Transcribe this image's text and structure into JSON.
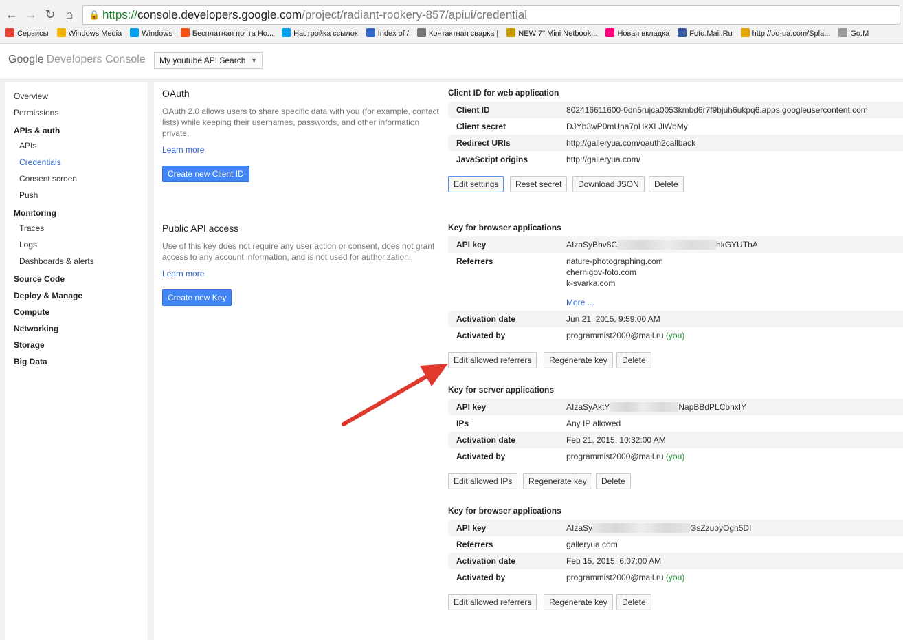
{
  "browser": {
    "url_scheme": "https://",
    "url_host": "console.developers.google.com",
    "url_path": "/project/radiant-rookery-857/apiui/credential",
    "bookmarks": [
      {
        "label": "Сервисы",
        "color": "#e94235"
      },
      {
        "label": "Windows Media",
        "color": "#f4b400"
      },
      {
        "label": "Windows",
        "color": "#00a1f1"
      },
      {
        "label": "Бесплатная почта Но...",
        "color": "#f65314"
      },
      {
        "label": "Настройка ссылок",
        "color": "#00a1f1"
      },
      {
        "label": "Index of /",
        "color": "#3366cc"
      },
      {
        "label": "Контактная сварка |",
        "color": "#777777"
      },
      {
        "label": "NEW 7\" Mini Netbook...",
        "color": "#c89b00"
      },
      {
        "label": "Новая вкладка",
        "color": "#ff0084"
      },
      {
        "label": "Foto.Mail.Ru",
        "color": "#3a5ba0"
      },
      {
        "label": "http://po-ua.com/Spla...",
        "color": "#e3a600"
      },
      {
        "label": "Go.M",
        "color": "#999999"
      }
    ]
  },
  "header": {
    "logo_google": "Google",
    "logo_product": "Developers Console",
    "project_select": "My youtube API Search"
  },
  "sidebar": {
    "items": [
      {
        "label": "Overview"
      },
      {
        "label": "Permissions"
      },
      {
        "label": "APIs & auth"
      },
      {
        "label": "APIs"
      },
      {
        "label": "Credentials"
      },
      {
        "label": "Consent screen"
      },
      {
        "label": "Push"
      },
      {
        "label": "Monitoring"
      },
      {
        "label": "Traces"
      },
      {
        "label": "Logs"
      },
      {
        "label": "Dashboards & alerts"
      },
      {
        "label": "Source Code"
      },
      {
        "label": "Deploy & Manage"
      },
      {
        "label": "Compute"
      },
      {
        "label": "Networking"
      },
      {
        "label": "Storage"
      },
      {
        "label": "Big Data"
      }
    ]
  },
  "oauth": {
    "title": "OAuth",
    "description": "OAuth 2.0 allows users to share specific data with you (for example, contact lists) while keeping their usernames, passwords, and other information private.",
    "learn_more": "Learn more",
    "create_button": "Create new Client ID"
  },
  "public_api": {
    "title": "Public API access",
    "description": "Use of this key does not require any user action or consent, does not grant access to any account information, and is not used for authorization.",
    "learn_more": "Learn more",
    "create_button": "Create new Key"
  },
  "web_client": {
    "title": "Client ID for web application",
    "client_id_label": "Client ID",
    "client_id": "802416611600-0dn5rujca0053kmbd6r7f9bjuh6ukpq6.apps.googleusercontent.com",
    "client_secret_label": "Client secret",
    "client_secret": "DJYb3wP0mUna7oHkXLJlWbMy",
    "redirect_label": "Redirect URIs",
    "redirect": "http://galleryua.com/oauth2callback",
    "origins_label": "JavaScript origins",
    "origins": "http://galleryua.com/",
    "buttons": {
      "edit": "Edit settings",
      "reset": "Reset secret",
      "download": "Download JSON",
      "delete": "Delete"
    }
  },
  "browser_key_1": {
    "title": "Key for browser applications",
    "api_key_label": "API key",
    "api_key_start": "AIzaSyBbv8C",
    "api_key_end": "hkGYUTbA",
    "referrers_label": "Referrers",
    "referrers": [
      "nature-photographing.com",
      "chernigov-foto.com",
      "k-svarka.com"
    ],
    "more": "More ...",
    "activation_label": "Activation date",
    "activation": "Jun 21, 2015, 9:59:00 AM",
    "activated_by_label": "Activated by",
    "activated_by": "programmist2000@mail.ru",
    "you": "(you)",
    "buttons": {
      "edit": "Edit allowed referrers",
      "regen": "Regenerate key",
      "delete": "Delete"
    }
  },
  "server_key": {
    "title": "Key for server applications",
    "api_key_label": "API key",
    "api_key_start": "AIzaSyAktY",
    "api_key_end": "NapBBdPLCbnxIY",
    "ips_label": "IPs",
    "ips": "Any IP allowed",
    "activation_label": "Activation date",
    "activation": "Feb 21, 2015, 10:32:00 AM",
    "activated_by_label": "Activated by",
    "activated_by": "programmist2000@mail.ru",
    "you": "(you)",
    "buttons": {
      "edit": "Edit allowed IPs",
      "regen": "Regenerate key",
      "delete": "Delete"
    }
  },
  "browser_key_2": {
    "title": "Key for browser applications",
    "api_key_label": "API key",
    "api_key_start": "AIzaSy",
    "api_key_end": "GsZzuoyOgh5DI",
    "referrers_label": "Referrers",
    "referrers": "galleryua.com",
    "activation_label": "Activation date",
    "activation": "Feb 15, 2015, 6:07:00 AM",
    "activated_by_label": "Activated by",
    "activated_by": "programmist2000@mail.ru",
    "you": "(you)",
    "buttons": {
      "edit": "Edit allowed referrers",
      "regen": "Regenerate key",
      "delete": "Delete"
    }
  },
  "colors": {
    "accent": "#4285f4",
    "link": "#3366cc",
    "you": "#1c8a2c",
    "arrow": "#e03a2f"
  }
}
